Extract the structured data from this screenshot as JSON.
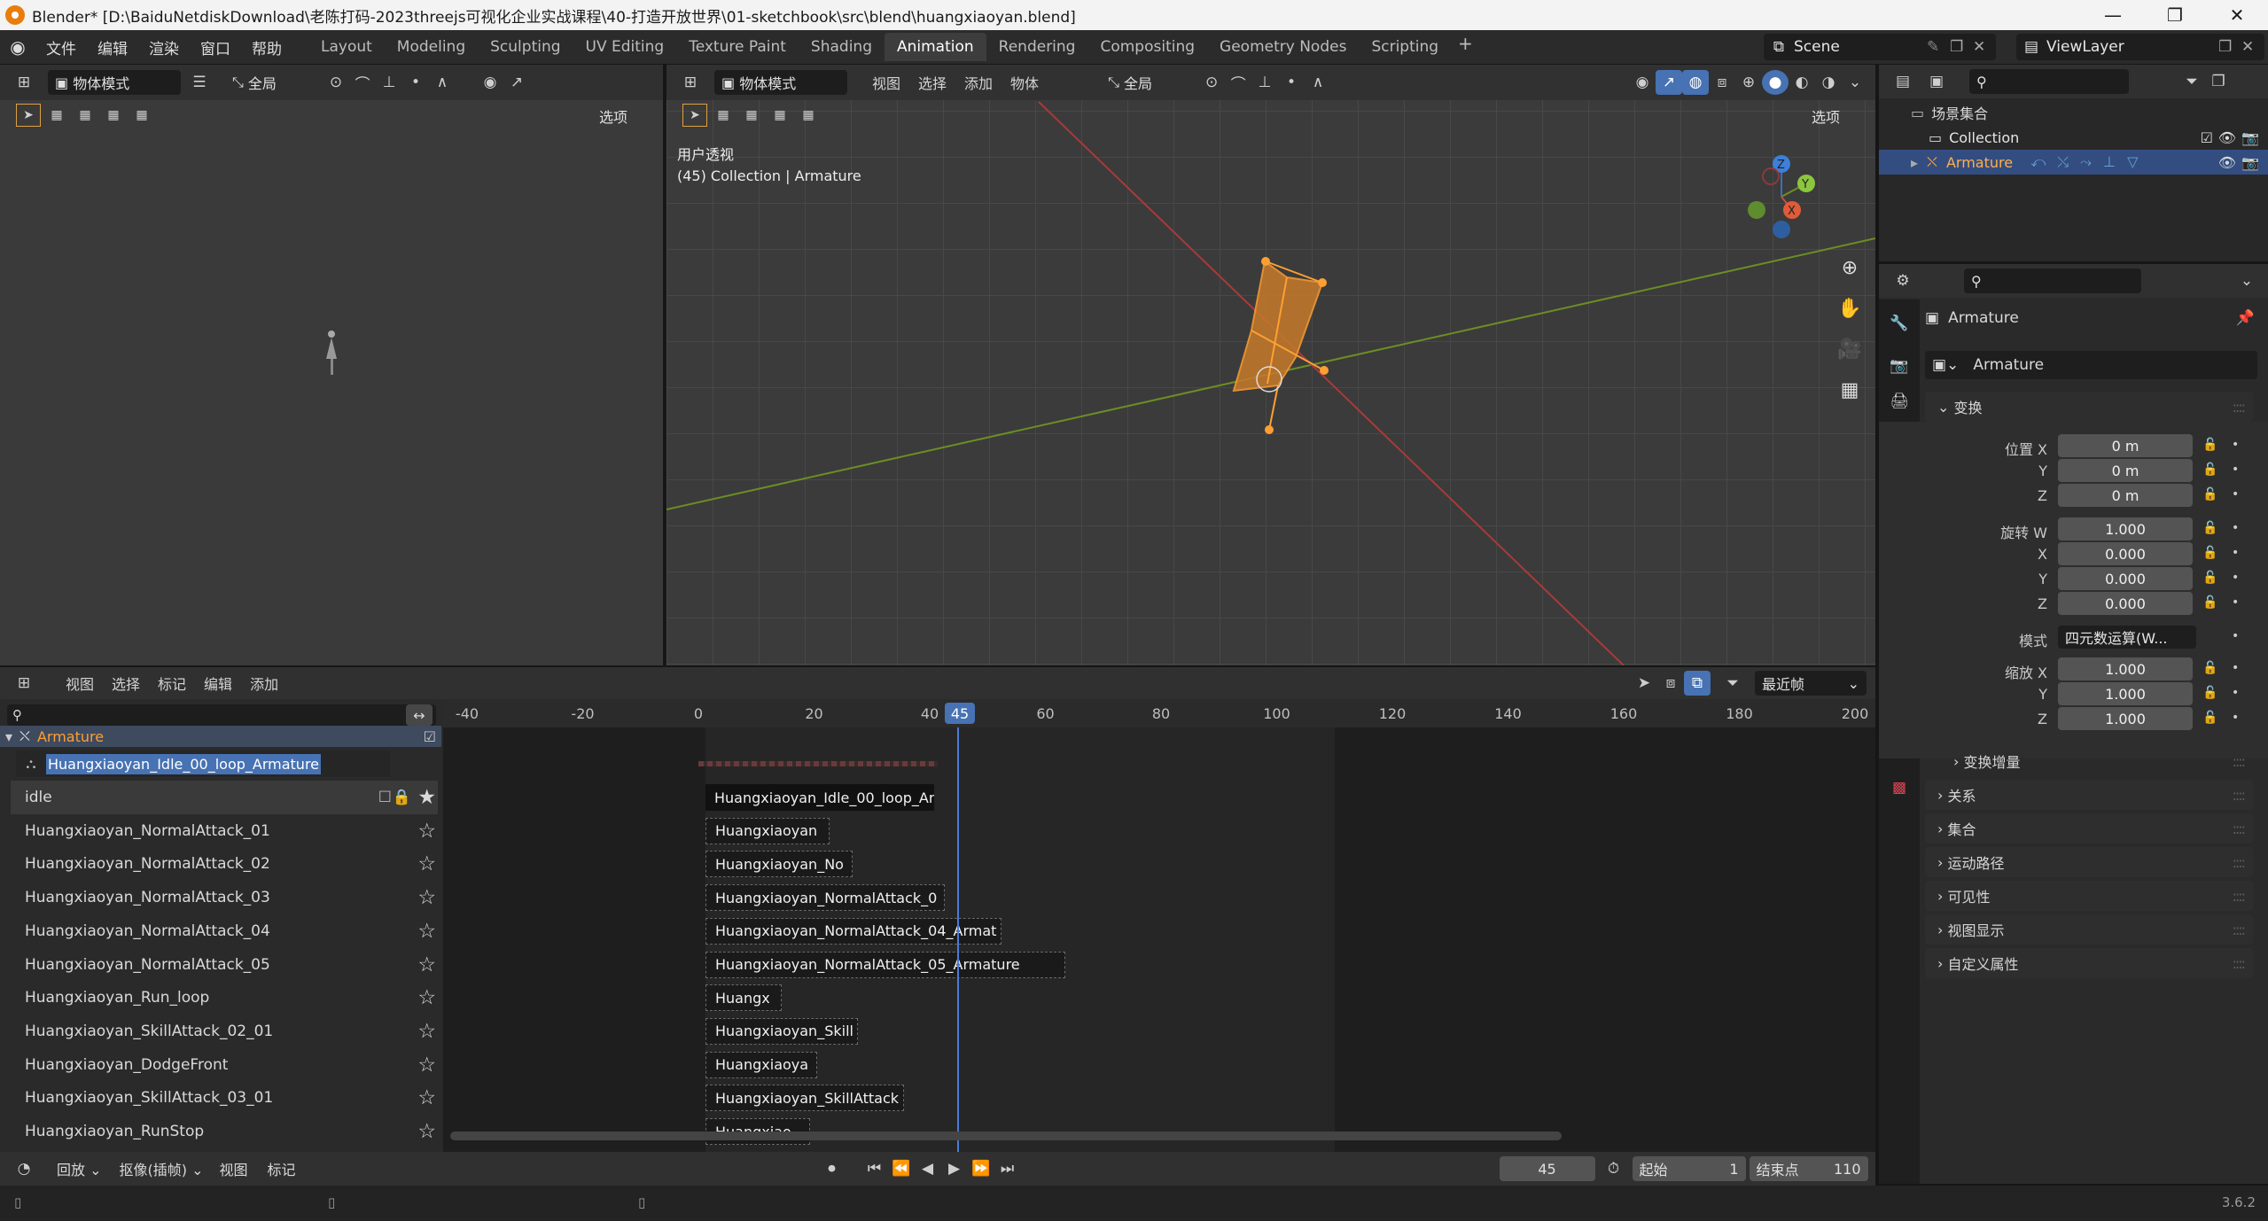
{
  "window": {
    "title": "Blender* [D:\\BaiduNetdiskDownload\\老陈打码-2023threejs可视化企业实战课程\\40-打造开放世界\\01-sketchbook\\src\\blend\\huangxiaoyan.blend]",
    "min": "—",
    "max": "❐",
    "close": "✕"
  },
  "menu": [
    "文件",
    "编辑",
    "渲染",
    "窗口",
    "帮助"
  ],
  "workspaces": [
    {
      "label": "Layout",
      "active": false
    },
    {
      "label": "Modeling",
      "active": false
    },
    {
      "label": "Sculpting",
      "active": false
    },
    {
      "label": "UV Editing",
      "active": false
    },
    {
      "label": "Texture Paint",
      "active": false
    },
    {
      "label": "Shading",
      "active": false
    },
    {
      "label": "Animation",
      "active": true
    },
    {
      "label": "Rendering",
      "active": false
    },
    {
      "label": "Compositing",
      "active": false
    },
    {
      "label": "Geometry Nodes",
      "active": false
    },
    {
      "label": "Scripting",
      "active": false
    }
  ],
  "add_workspace": "+",
  "scene": {
    "label": "Scene"
  },
  "view_layer": {
    "label": "ViewLayer"
  },
  "left_viewport": {
    "mode": "物体模式",
    "orientation": "全局",
    "options": "选项"
  },
  "main_viewport": {
    "mode": "物体模式",
    "menus": [
      "视图",
      "选择",
      "添加",
      "物体"
    ],
    "orientation": "全局",
    "options": "选项",
    "view_name": "用户透视",
    "info": "(45) Collection | Armature",
    "gizmo": {
      "x": "X",
      "y": "Y",
      "z": "Z"
    }
  },
  "outliner": {
    "root": "场景集合",
    "collection": "Collection",
    "object": "Armature"
  },
  "properties": {
    "object_header": "Armature",
    "object_name": "Armature",
    "transform_label": "变换",
    "location": {
      "label": "位置 X",
      "y_label": "Y",
      "z_label": "Z",
      "x": "0 m",
      "y": "0 m",
      "z": "0 m"
    },
    "rotation": {
      "label": "旋转 W",
      "x_label": "X",
      "y_label": "Y",
      "z_label": "Z",
      "w": "1.000",
      "x": "0.000",
      "y": "0.000",
      "z": "0.000"
    },
    "mode": {
      "label": "模式",
      "value": "四元数运算(W..."
    },
    "scale": {
      "label": "缩放 X",
      "y_label": "Y",
      "z_label": "Z",
      "x": "1.000",
      "y": "1.000",
      "z": "1.000"
    },
    "delta": "变换增量",
    "sections": [
      "关系",
      "集合",
      "运动路径",
      "可见性",
      "视图显示",
      "自定义属性"
    ]
  },
  "nla": {
    "menus": [
      "视图",
      "选择",
      "标记",
      "编辑",
      "添加"
    ],
    "snap": "最近帧",
    "object": "Armature",
    "action_name": "Huangxiaoyan_Idle_00_loop_Armature",
    "ruler": [
      "-40",
      "-20",
      "0",
      "20",
      "40",
      "60",
      "80",
      "100",
      "120",
      "140",
      "160",
      "180",
      "200"
    ],
    "current_frame_marker": "45",
    "tracks": [
      {
        "name": "idle",
        "strip": "Huangxiaoyan_Idle_00_loop_Ar"
      },
      {
        "name": "Huangxiaoyan_NormalAttack_01",
        "strip": "Huangxiaoyan"
      },
      {
        "name": "Huangxiaoyan_NormalAttack_02",
        "strip": "Huangxiaoyan_No"
      },
      {
        "name": "Huangxiaoyan_NormalAttack_03",
        "strip": "Huangxiaoyan_NormalAttack_0"
      },
      {
        "name": "Huangxiaoyan_NormalAttack_04",
        "strip": "Huangxiaoyan_NormalAttack_04_Armat"
      },
      {
        "name": "Huangxiaoyan_NormalAttack_05",
        "strip": "Huangxiaoyan_NormalAttack_05_Armature"
      },
      {
        "name": "Huangxiaoyan_Run_loop",
        "strip": "Huangx"
      },
      {
        "name": "Huangxiaoyan_SkillAttack_02_01",
        "strip": "Huangxiaoyan_Skill"
      },
      {
        "name": "Huangxiaoyan_DodgeFront",
        "strip": "Huangxiaoya"
      },
      {
        "name": "Huangxiaoyan_SkillAttack_03_01",
        "strip": "Huangxiaoyan_SkillAttack"
      },
      {
        "name": "Huangxiaoyan_RunStop",
        "strip": "Huangxiao"
      }
    ]
  },
  "timeline": {
    "playback": "回放",
    "keying": "抠像(插帧)",
    "menus": [
      "视图",
      "标记"
    ],
    "current_frame": "45",
    "start_label": "起始",
    "start": "1",
    "end_label": "结束点",
    "end": "110"
  },
  "status": {
    "version": "3.6.2"
  }
}
